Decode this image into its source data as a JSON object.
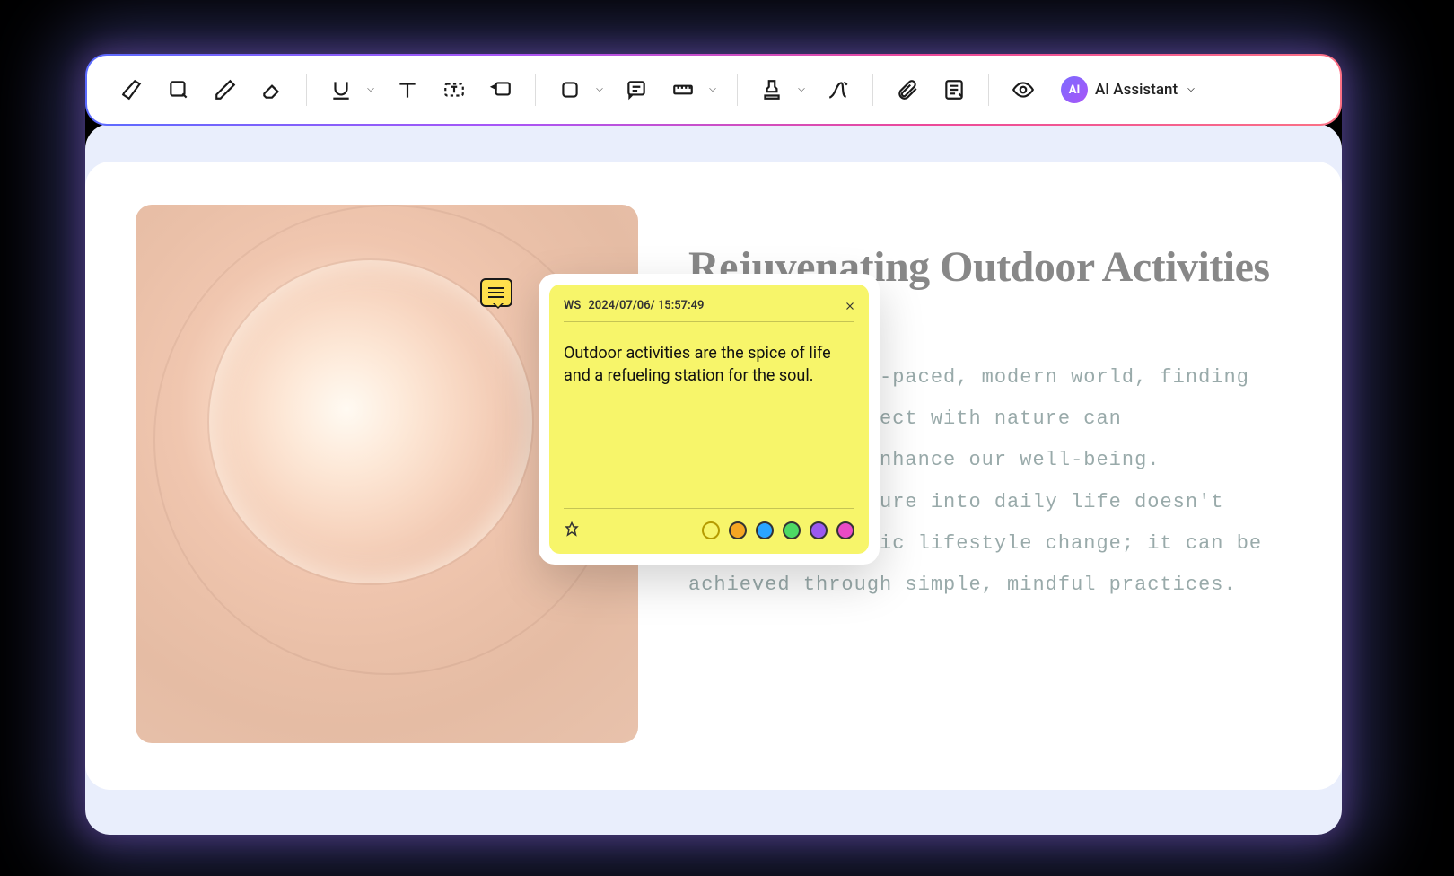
{
  "toolbar": {
    "ai_label": "AI Assistant",
    "ai_badge": "AI"
  },
  "document": {
    "heading": "Rejuvenating Outdoor Activities",
    "body": "In today's fast-paced, modern world, finding moments to connect with nature can significantly enhance our well-being. Integrating nature into daily life doesn't require a drastic lifestyle change; it can be achieved through simple, mindful practices."
  },
  "sticky": {
    "author": "WS",
    "timestamp": "2024/07/06/ 15:57:49",
    "text": "Outdoor activities are the spice of life and a refueling station for the soul.",
    "colors": [
      "#f7f56a",
      "#f5a623",
      "#2aa5ff",
      "#4cd964",
      "#9b59f0",
      "#e94bc5"
    ]
  }
}
